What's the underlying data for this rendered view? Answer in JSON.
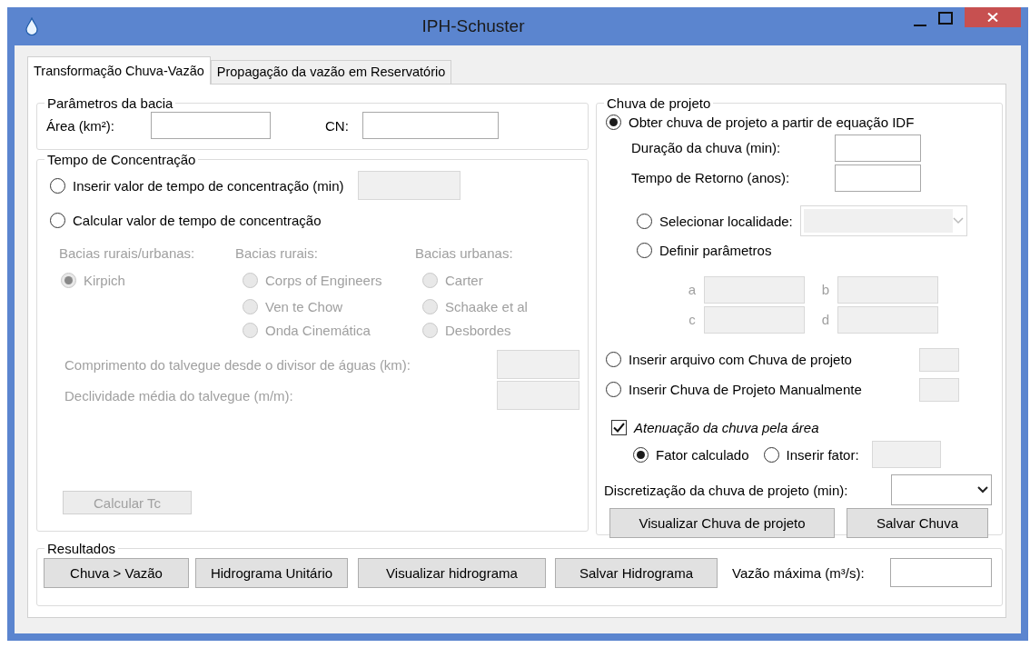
{
  "window": {
    "title": "IPH-Schuster"
  },
  "tabs": [
    {
      "label": "Transformação Chuva-Vazão",
      "selected": true
    },
    {
      "label": "Propagação da vazão em Reservatório",
      "selected": false
    }
  ],
  "basin_parameters": {
    "title": "Parâmetros da bacia",
    "fields": [
      {
        "label": "Área (km²):",
        "disabled": false
      },
      {
        "label": "CN:",
        "disabled": false
      }
    ]
  },
  "concentration_time": {
    "title": "Tempo de Concentração",
    "options": [
      {
        "label": "Inserir valor de tempo de concentração (min)",
        "selected": false,
        "field_disabled": true
      },
      {
        "label": "Calcular valor de tempo de concentração",
        "selected": false
      }
    ],
    "methods_disabled": true,
    "methods": [
      {
        "heading": "Bacias rurais/urbanas:",
        "options": [
          {
            "label": "Kirpich",
            "selected": true
          }
        ]
      },
      {
        "heading": "Bacias rurais:",
        "options": [
          {
            "label": "Corps of Engineers",
            "selected": false
          },
          {
            "label": "Ven te Chow",
            "selected": false
          },
          {
            "label": "Onda Cinemática",
            "selected": false
          }
        ]
      },
      {
        "heading": "Bacias urbanas:",
        "options": [
          {
            "label": "Carter",
            "selected": false
          },
          {
            "label": "Schaake et al",
            "selected": false
          },
          {
            "label": "Desbordes",
            "selected": false
          }
        ]
      }
    ],
    "fields": [
      {
        "label": "Comprimento do talvegue desde o divisor de águas (km):",
        "disabled": true
      },
      {
        "label": "Declividade média  do talvegue (m/m):",
        "disabled": true
      }
    ],
    "button": {
      "label": "Calcular Tc",
      "disabled": true
    }
  },
  "design_rain": {
    "title": "Chuva de projeto",
    "idf": {
      "label": "Obter chuva de projeto a partir de equação IDF",
      "selected": true,
      "fields": [
        {
          "label": "Duração da chuva (min):",
          "disabled": false
        },
        {
          "label": "Tempo de Retorno (anos):",
          "disabled": false
        }
      ],
      "sources": [
        {
          "kind": "dropdown",
          "label": "Selecionar localidade:",
          "selected": false,
          "disabled": true
        },
        {
          "kind": "params",
          "label": "Definir parâmetros",
          "selected": false
        }
      ],
      "params_disabled": true,
      "params": [
        {
          "label": "a"
        },
        {
          "label": "b"
        },
        {
          "label": "c"
        },
        {
          "label": "d"
        }
      ]
    },
    "other_options": [
      {
        "label": "Inserir arquivo com Chuva de projeto",
        "selected": false,
        "field_disabled": true
      },
      {
        "label": "Inserir Chuva de Projeto Manualmente",
        "selected": false,
        "field_disabled": true
      }
    ],
    "attenuation": {
      "label": "Atenuação da chuva pela área",
      "checked": true,
      "options": [
        {
          "label": "Fator calculado",
          "selected": true
        },
        {
          "label": "Inserir fator:",
          "selected": false
        }
      ],
      "field_disabled": true
    },
    "discretization": {
      "label": "Discretização da chuva de projeto (min):"
    },
    "buttons": [
      "Visualizar Chuva de projeto",
      "Salvar Chuva"
    ]
  },
  "results": {
    "title": "Resultados",
    "buttons": [
      "Chuva > Vazão",
      "Hidrograma Unitário",
      "Visualizar hidrograma",
      "Salvar Hidrograma"
    ],
    "max_flow": {
      "label": "Vazão máxima (m³/s):"
    }
  }
}
